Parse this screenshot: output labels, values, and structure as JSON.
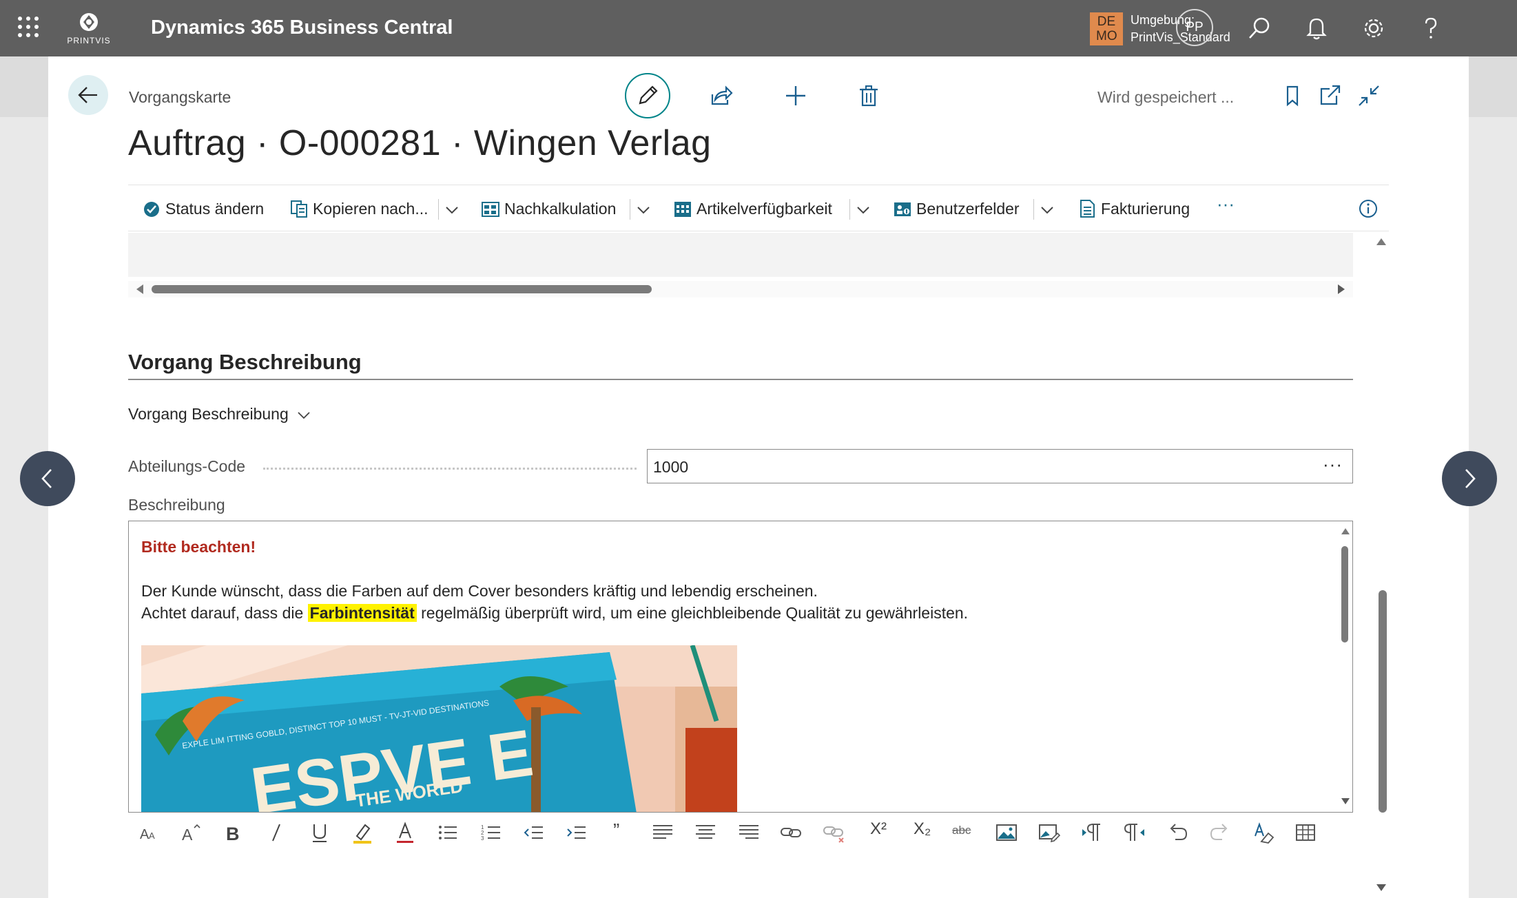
{
  "appbar": {
    "logo_text": "PRINTVIS",
    "title": "Dynamics 365 Business Central",
    "env_badge": "DE MO",
    "env_label": "Umgebung:",
    "env_value": "PrintVis_Standard",
    "avatar_initials": "PP",
    "icons": [
      "waffle-icon",
      "search-icon",
      "bell-icon",
      "gear-icon",
      "help-icon"
    ]
  },
  "page": {
    "breadcrumb": "Vorgangskarte",
    "title": "Auftrag · O-000281 · Wingen Verlag",
    "saving_status": "Wird gespeichert ..."
  },
  "actions": [
    {
      "label": "Status ändern",
      "icon": "status-change-icon"
    },
    {
      "label": "Kopieren nach...",
      "icon": "copy-icon",
      "has_dropdown": true
    },
    {
      "label": "Nachkalkulation",
      "icon": "calculation-icon",
      "has_dropdown": true
    },
    {
      "label": "Artikelverfügbarkeit",
      "icon": "availability-icon",
      "has_dropdown": true
    },
    {
      "label": "Benutzerfelder",
      "icon": "user-fields-icon",
      "has_dropdown": true
    },
    {
      "label": "Fakturierung",
      "icon": "invoice-icon"
    }
  ],
  "more_actions": "···",
  "section": {
    "title": "Vorgang Beschreibung",
    "group_toggle": "Vorgang Beschreibung",
    "department_label": "Abteilungs-Code",
    "department_value": "1000",
    "department_more": "···",
    "description_label": "Beschreibung"
  },
  "description": {
    "warning": "Bitte beachten!",
    "line1": "Der Kunde wünscht, dass die Farben auf dem Cover besonders kräftig und lebendig erscheinen.",
    "line2_before": "Achtet darauf, dass die ",
    "line2_highlight": "Farbintensität",
    "line2_after": " regelmäßig überprüft wird, um eine gleichbleibende Qualität zu gewährleisten.",
    "image_text_big": "ESPVE E",
    "image_text_small": "EXPLE LIM ITTING GOBLD, DISTINCT TOP 10 MUST - TV-JT-VID DESTINATIONS",
    "image_text_world": "THE WORLD"
  },
  "richtext_toolbar": {
    "superscript": "X²",
    "subscript": "X₂",
    "strike": "abc",
    "quote": "”",
    "icons": [
      "font-size-icon",
      "font-grow-icon",
      "bold-icon",
      "italic-icon",
      "underline-icon",
      "highlight-icon",
      "font-color-icon",
      "bullets-icon",
      "numbering-icon",
      "outdent-icon",
      "indent-icon",
      "quote-icon",
      "align-left-icon",
      "align-center-icon",
      "align-right-icon",
      "link-icon",
      "unlink-icon",
      "superscript-icon",
      "subscript-icon",
      "strikethrough-icon",
      "image-icon",
      "image-edit-icon",
      "ltr-icon",
      "rtl-icon",
      "undo-icon",
      "redo-icon",
      "clear-format-icon",
      "table-icon"
    ]
  },
  "colors": {
    "appbar": "#5f5f5f",
    "accent": "#008489",
    "warning": "#b12a1f",
    "highlight": "#fff200",
    "env_badge": "#e08a4d",
    "nav_button": "#3f4a5c"
  }
}
